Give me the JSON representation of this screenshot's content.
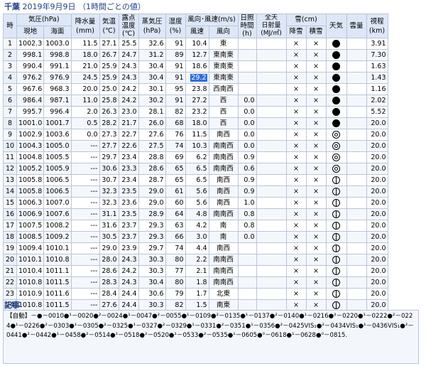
{
  "title": {
    "city": "千葉",
    "date": "2019年9月9日",
    "note": "（1時間ごとの値）"
  },
  "headers": {
    "hour": "時",
    "pressure": "気圧(hPa)",
    "pressure_station": "現地",
    "pressure_sea": "海面",
    "precip": "降水量\n(mm)",
    "temp": "気温\n(℃)",
    "dew": "露点\n温度\n(℃)",
    "vapor": "蒸気圧\n(hPa)",
    "humidity": "湿度\n(%)",
    "wind": "風向･風速(m/s)",
    "wind_speed": "風速",
    "wind_dir": "風向",
    "sunshine": "日照\n時間\n(h)",
    "radiation": "全天\n日射量\n(MJ/㎡)",
    "snow": "雪(cm)",
    "snowfall": "降雪",
    "snowdepth": "積雪",
    "weather": "天気",
    "cloud": "雲量",
    "visibility": "視程\n(km)"
  },
  "rows": [
    {
      "h": "1",
      "ps": "1002.3",
      "sl": "1003.0",
      "pr": "11.5",
      "t": "27.1",
      "dp": "25.5",
      "vp": "32.6",
      "hu": "91",
      "ws": "10.4",
      "wd": "東",
      "sun": "",
      "rad": "",
      "sf": "×",
      "sd": "×",
      "wx": "rain",
      "vis": "3.91"
    },
    {
      "h": "2",
      "ps": "998.1",
      "sl": "998.8",
      "pr": "18.0",
      "t": "26.7",
      "dp": "24.7",
      "vp": "31.2",
      "hu": "89",
      "ws": "12.7",
      "wd": "東南東",
      "sun": "",
      "rad": "",
      "sf": "×",
      "sd": "×",
      "wx": "rain",
      "vis": "7.30"
    },
    {
      "h": "3",
      "ps": "990.4",
      "sl": "991.1",
      "pr": "21.0",
      "t": "25.9",
      "dp": "24.3",
      "vp": "30.4",
      "hu": "91",
      "ws": "18.6",
      "wd": "東南東",
      "sun": "",
      "rad": "",
      "sf": "×",
      "sd": "×",
      "wx": "rain",
      "vis": "1.63"
    },
    {
      "h": "4",
      "ps": "976.2",
      "sl": "976.9",
      "pr": "24.5",
      "t": "25.9",
      "dp": "24.3",
      "vp": "30.4",
      "hu": "91",
      "ws": "29.2",
      "wd": "東南東",
      "sun": "",
      "rad": "",
      "sf": "×",
      "sd": "×",
      "wx": "rain",
      "vis": "1.43"
    },
    {
      "h": "5",
      "ps": "967.6",
      "sl": "968.3",
      "pr": "20.0",
      "t": "25.0",
      "dp": "24.2",
      "vp": "30.1",
      "hu": "95",
      "ws": "23.8",
      "wd": "西南西",
      "sun": "",
      "rad": "",
      "sf": "×",
      "sd": "×",
      "wx": "rain",
      "vis": "1.16"
    },
    {
      "h": "6",
      "ps": "986.4",
      "sl": "987.1",
      "pr": "11.0",
      "t": "25.8",
      "dp": "24.2",
      "vp": "30.2",
      "hu": "91",
      "ws": "27.2",
      "wd": "西",
      "sun": "0.0",
      "rad": "",
      "sf": "×",
      "sd": "×",
      "wx": "rain",
      "vis": "2.02"
    },
    {
      "h": "7",
      "ps": "995.7",
      "sl": "996.4",
      "pr": "2.0",
      "t": "26.3",
      "dp": "23.0",
      "vp": "28.1",
      "hu": "82",
      "ws": "23.2",
      "wd": "西",
      "sun": "0.0",
      "rad": "",
      "sf": "×",
      "sd": "×",
      "wx": "rain",
      "vis": "5.52"
    },
    {
      "h": "8",
      "ps": "1001.0",
      "sl": "1001.7",
      "pr": "0.5",
      "t": "28.2",
      "dp": "21.7",
      "vp": "26.0",
      "hu": "68",
      "ws": "18.0",
      "wd": "西",
      "sun": "0.0",
      "rad": "",
      "sf": "×",
      "sd": "×",
      "wx": "rain",
      "vis": "20.0"
    },
    {
      "h": "9",
      "ps": "1002.9",
      "sl": "1003.6",
      "pr": "0.0",
      "t": "27.3",
      "dp": "22.7",
      "vp": "27.6",
      "hu": "76",
      "ws": "11.5",
      "wd": "南西",
      "sun": "0.0",
      "rad": "",
      "sf": "×",
      "sd": "×",
      "wx": "cloudy",
      "vis": "20.0"
    },
    {
      "h": "10",
      "ps": "1004.3",
      "sl": "1005.0",
      "pr": "---",
      "t": "27.7",
      "dp": "22.6",
      "vp": "27.5",
      "hu": "74",
      "ws": "10.3",
      "wd": "南南西",
      "sun": "0.0",
      "rad": "",
      "sf": "×",
      "sd": "×",
      "wx": "cloudy",
      "vis": "20.0"
    },
    {
      "h": "11",
      "ps": "1004.8",
      "sl": "1005.5",
      "pr": "---",
      "t": "29.7",
      "dp": "23.4",
      "vp": "28.8",
      "hu": "69",
      "ws": "6.2",
      "wd": "南南西",
      "sun": "0.9",
      "rad": "",
      "sf": "×",
      "sd": "×",
      "wx": "cloudy",
      "vis": "20.0"
    },
    {
      "h": "12",
      "ps": "1005.2",
      "sl": "1005.9",
      "pr": "---",
      "t": "30.6",
      "dp": "23.3",
      "vp": "28.6",
      "hu": "65",
      "ws": "6.5",
      "wd": "南南西",
      "sun": "0.6",
      "rad": "",
      "sf": "×",
      "sd": "×",
      "wx": "cloudy",
      "vis": "20.0"
    },
    {
      "h": "13",
      "ps": "1005.8",
      "sl": "1006.5",
      "pr": "---",
      "t": "30.7",
      "dp": "23.4",
      "vp": "28.7",
      "hu": "65",
      "ws": "6.5",
      "wd": "南西",
      "sun": "0.9",
      "rad": "",
      "sf": "×",
      "sd": "×",
      "wx": "bkn",
      "vis": "20.0"
    },
    {
      "h": "14",
      "ps": "1005.8",
      "sl": "1006.5",
      "pr": "---",
      "t": "32.3",
      "dp": "23.5",
      "vp": "29.0",
      "hu": "61",
      "ws": "5.6",
      "wd": "南西",
      "sun": "0.9",
      "rad": "",
      "sf": "×",
      "sd": "×",
      "wx": "bkn",
      "vis": "20.0"
    },
    {
      "h": "15",
      "ps": "1006.3",
      "sl": "1007.0",
      "pr": "---",
      "t": "32.3",
      "dp": "23.6",
      "vp": "29.0",
      "hu": "60",
      "ws": "5.6",
      "wd": "南西",
      "sun": "1.0",
      "rad": "",
      "sf": "×",
      "sd": "×",
      "wx": "bkn",
      "vis": "20.0"
    },
    {
      "h": "16",
      "ps": "1006.9",
      "sl": "1007.6",
      "pr": "---",
      "t": "31.1",
      "dp": "23.5",
      "vp": "28.9",
      "hu": "64",
      "ws": "4.8",
      "wd": "南南西",
      "sun": "0.8",
      "rad": "",
      "sf": "×",
      "sd": "×",
      "wx": "bkn",
      "vis": "20.0"
    },
    {
      "h": "17",
      "ps": "1007.5",
      "sl": "1008.2",
      "pr": "---",
      "t": "31.6",
      "dp": "23.7",
      "vp": "29.3",
      "hu": "63",
      "ws": "4.2",
      "wd": "南",
      "sun": "0.8",
      "rad": "",
      "sf": "×",
      "sd": "×",
      "wx": "bkn",
      "vis": "20.0"
    },
    {
      "h": "18",
      "ps": "1008.5",
      "sl": "1009.2",
      "pr": "---",
      "t": "30.5",
      "dp": "23.7",
      "vp": "29.3",
      "hu": "66",
      "ws": "3.0",
      "wd": "南",
      "sun": "0.0",
      "rad": "",
      "sf": "×",
      "sd": "×",
      "wx": "bkn",
      "vis": "20.0"
    },
    {
      "h": "19",
      "ps": "1009.4",
      "sl": "1010.1",
      "pr": "---",
      "t": "29.0",
      "dp": "23.9",
      "vp": "29.7",
      "hu": "74",
      "ws": "4.4",
      "wd": "南西",
      "sun": "",
      "rad": "",
      "sf": "×",
      "sd": "×",
      "wx": "bkn",
      "vis": "20.0"
    },
    {
      "h": "20",
      "ps": "1010.1",
      "sl": "1010.8",
      "pr": "---",
      "t": "28.0",
      "dp": "24.3",
      "vp": "30.3",
      "hu": "80",
      "ws": "2.2",
      "wd": "南南西",
      "sun": "",
      "rad": "",
      "sf": "×",
      "sd": "×",
      "wx": "bkn",
      "vis": "20.0"
    },
    {
      "h": "21",
      "ps": "1010.4",
      "sl": "1011.1",
      "pr": "---",
      "t": "28.6",
      "dp": "24.2",
      "vp": "30.3",
      "hu": "77",
      "ws": "2.1",
      "wd": "南南西",
      "sun": "",
      "rad": "",
      "sf": "×",
      "sd": "×",
      "wx": "bkn",
      "vis": "20.0"
    },
    {
      "h": "22",
      "ps": "1010.8",
      "sl": "1011.5",
      "pr": "---",
      "t": "28.3",
      "dp": "24.3",
      "vp": "30.4",
      "hu": "80",
      "ws": "1.8",
      "wd": "南南西",
      "sun": "",
      "rad": "",
      "sf": "×",
      "sd": "×",
      "wx": "bkn",
      "vis": "20.0"
    },
    {
      "h": "23",
      "ps": "1010.9",
      "sl": "1011.6",
      "pr": "---",
      "t": "28.4",
      "dp": "24.4",
      "vp": "30.6",
      "hu": "79",
      "ws": "1.7",
      "wd": "北東",
      "sun": "",
      "rad": "",
      "sf": "×",
      "sd": "×",
      "wx": "bkn",
      "vis": "20.0"
    },
    {
      "h": "24",
      "ps": "1010.8",
      "sl": "1011.5",
      "pr": "---",
      "t": "27.6",
      "dp": "24.4",
      "vp": "30.3",
      "hu": "82",
      "ws": "1.5",
      "wd": "南東",
      "sun": "",
      "rad": "",
      "sf": "×",
      "sd": "×",
      "wx": "bkn",
      "vis": "20.0"
    }
  ],
  "highlight": {
    "row": 3,
    "field": "ws"
  },
  "notes": {
    "heading": "記事",
    "text": "【自動】－●－0010●¹－0020●²－0024●¹－0047●²－0055●¹－0109●²－0135●¹－0137●²－0140●¹－0216●²－0220●¹－0222●²－0224●¹－0226●²－0303●¹－0305●²－0325●¹－0327●²－0329●¹－0331●²－0351●¹－0356●²－0425VIS₁●²－0434VIS₁●¹－0436VIS₁●²－0441●²－0442●¹－0458●²－0514●¹－0518●²－0520●¹－0533●²－0535●¹－0605●⁰－0618●¹－0628●⁰－0815."
  }
}
